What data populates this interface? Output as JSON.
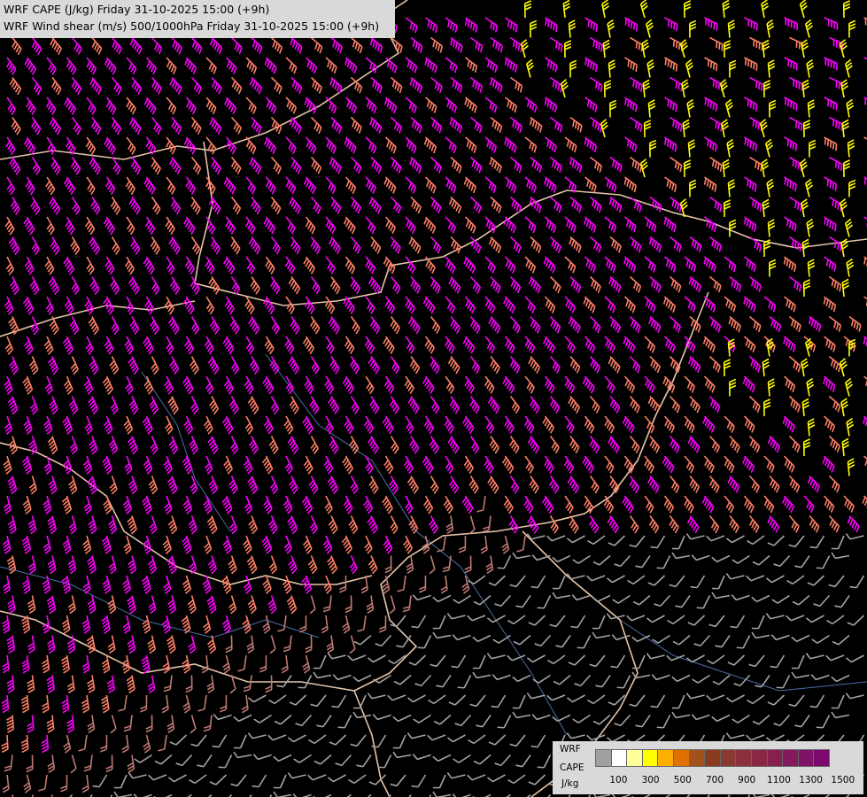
{
  "header": {
    "title_cape": "WRF CAPE (J/kg) Friday 31-10-2025 15:00 (+9h)",
    "title_shear": "WRF Wind shear (m/s) 500/1000hPa Friday 31-10-2025 15:00 (+9h)"
  },
  "legend": {
    "line1": "WRF",
    "line2": "CAPE",
    "unit": "J/kg",
    "swatch_colors": [
      "#a0a0a0",
      "#ffffff",
      "#ffff99",
      "#ffff00",
      "#ffb000",
      "#e07000",
      "#a0521a",
      "#8a3c20",
      "#8b3a32",
      "#8b2f3c",
      "#8a2844",
      "#86204f",
      "#821a5c",
      "#7f1266",
      "#7a0a6e"
    ],
    "ticks": [
      "100",
      "300",
      "500",
      "700",
      "900",
      "1100",
      "1300",
      "1500"
    ]
  },
  "barb_colors": {
    "magenta": "#ff00ff",
    "salmon": "#ff7f68",
    "yellow": "#ffff00",
    "rosy": "#c07a74",
    "grey": "#a3a3a3",
    "border": "#e6c4a8",
    "river": "#4a6fa5"
  }
}
